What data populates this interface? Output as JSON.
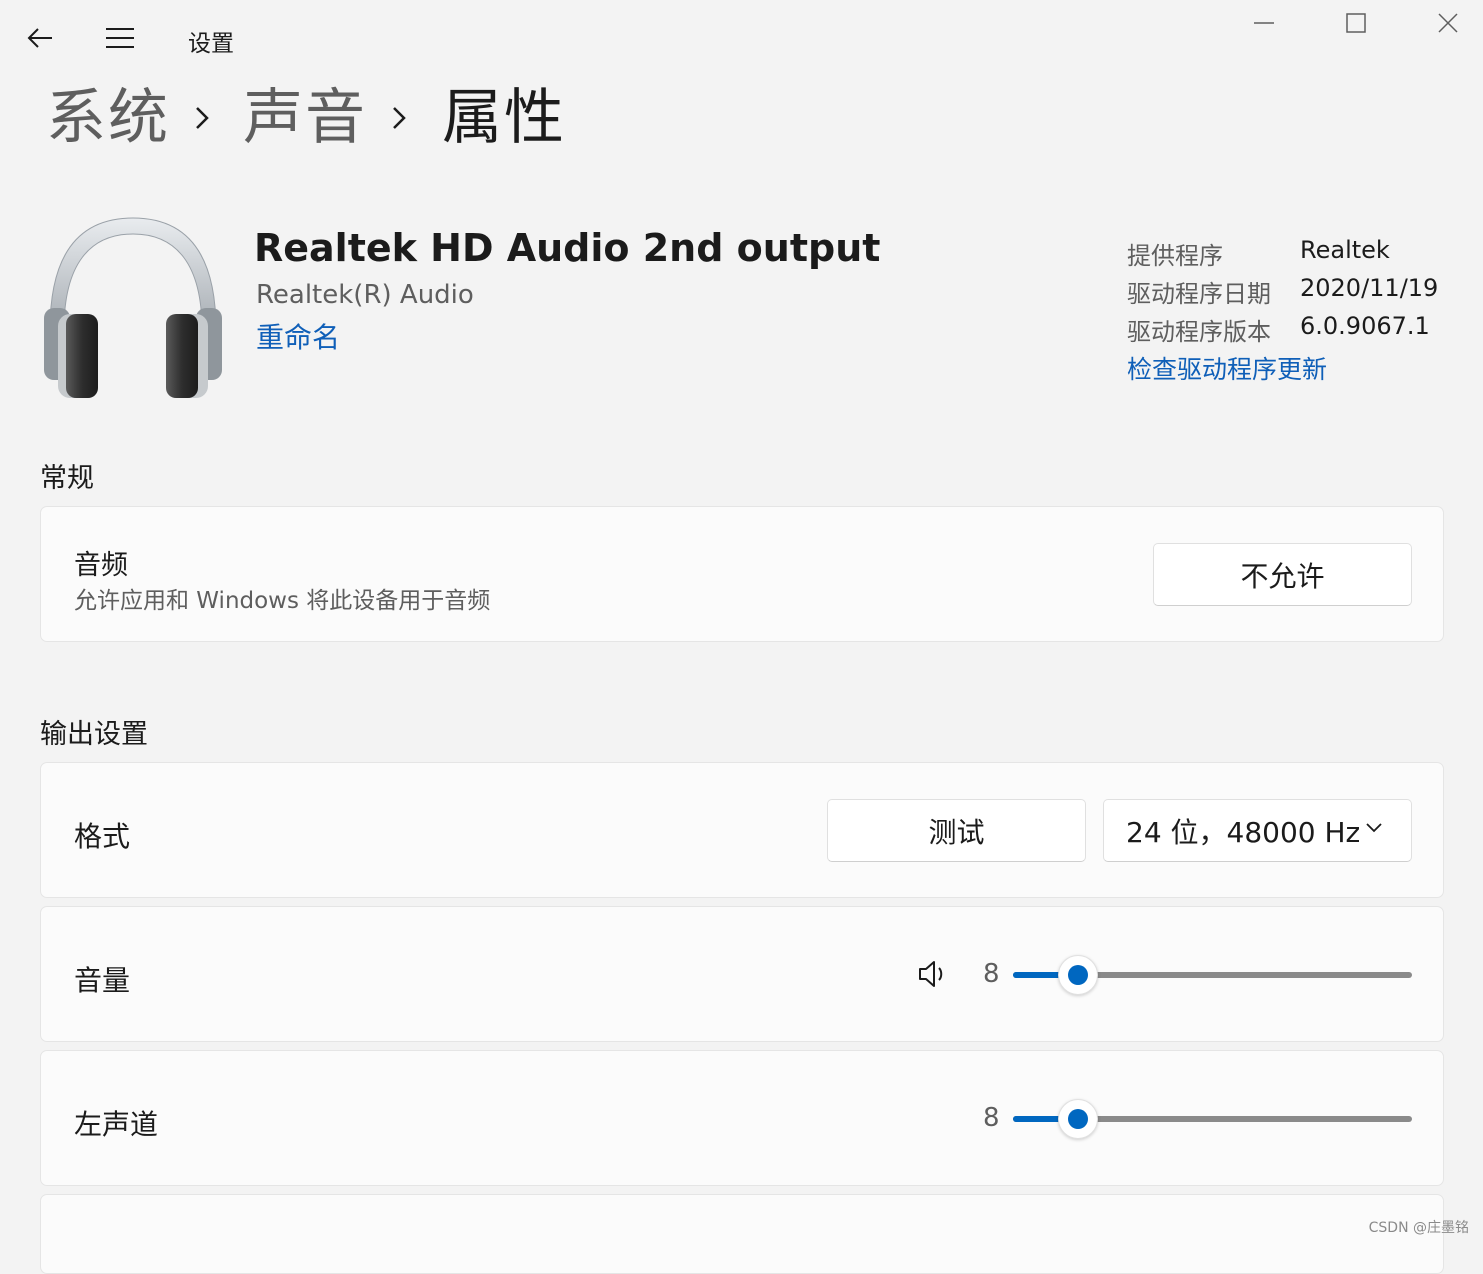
{
  "titlebar": {
    "app_title": "设置",
    "icons": [
      "back-arrow-icon",
      "hamburger-menu-icon",
      "minimize-icon",
      "maximize-icon",
      "close-icon"
    ]
  },
  "breadcrumb": {
    "items": [
      "系统",
      "声音",
      "属性"
    ]
  },
  "device": {
    "name": "Realtek HD Audio 2nd output",
    "subtitle": "Realtek(R) Audio",
    "rename_link": "重命名",
    "info": [
      {
        "label": "提供程序",
        "value": "Realtek"
      },
      {
        "label": "驱动程序日期",
        "value": "2020/11/19"
      },
      {
        "label": "驱动程序版本",
        "value": "6.0.9067.1"
      }
    ],
    "update_link": "检查驱动程序更新"
  },
  "general": {
    "title": "常规",
    "audio": {
      "title": "音频",
      "description": "允许应用和 Windows 将此设备用于音频",
      "button": "不允许"
    }
  },
  "output": {
    "title": "输出设置",
    "format": {
      "label": "格式",
      "test_button": "测试",
      "selected": "24 位，48000 Hz"
    },
    "volume": {
      "label": "音量",
      "value": "8",
      "level": 8
    },
    "left_channel": {
      "label": "左声道",
      "value": "8",
      "level": 8
    }
  },
  "watermark": "CSDN @庄墨铭",
  "colors": {
    "accent": "#0067c0",
    "link": "#0f5fb8",
    "background": "#f3f3f3",
    "card": "#fbfbfb"
  }
}
